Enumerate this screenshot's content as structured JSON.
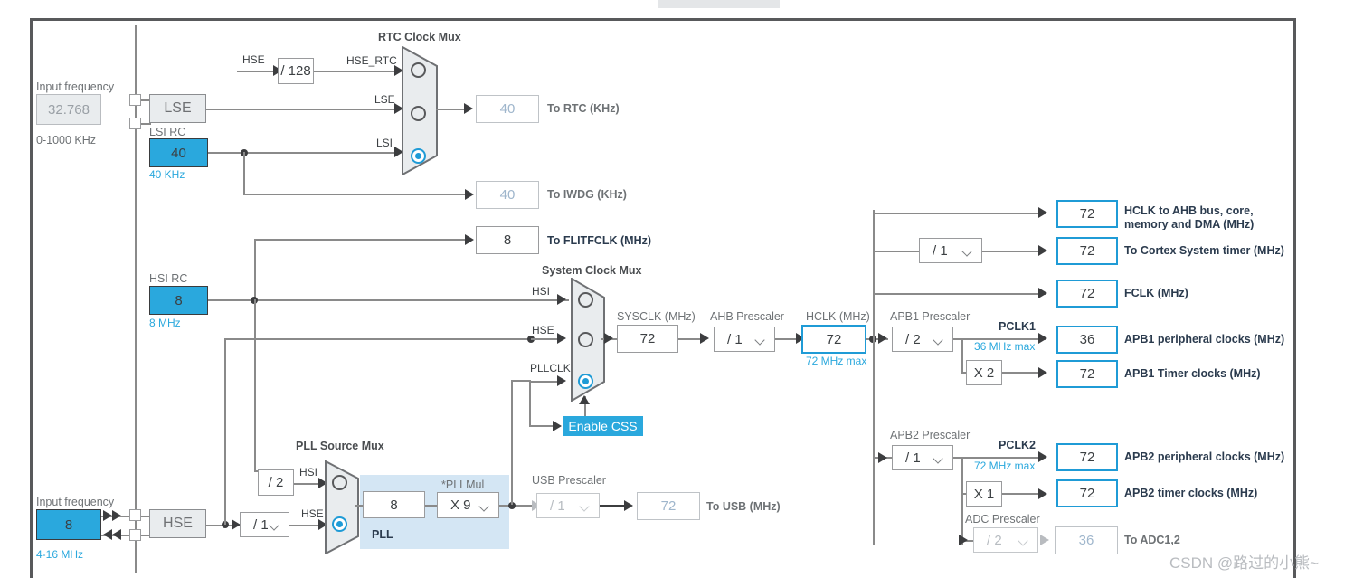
{
  "app": {
    "watermark": "CSDN @路过的小熊~"
  },
  "left_inputs": {
    "lse": {
      "caption": "Input frequency",
      "value": "32.768",
      "range": "0-1000 KHz",
      "osc_label": "LSE"
    },
    "lsi": {
      "title": "LSI RC",
      "value": "40",
      "unit": "40 KHz"
    },
    "hsi": {
      "title": "HSI RC",
      "value": "8",
      "unit": "8 MHz"
    },
    "hse": {
      "caption": "Input frequency",
      "value": "8",
      "range": "4-16 MHz",
      "osc_label": "HSE"
    }
  },
  "rtc_mux": {
    "title": "RTC Clock Mux",
    "hse_in_label": "HSE",
    "divider": "/ 128",
    "hse_rtc_label": "HSE_RTC",
    "lse_label": "LSE",
    "lsi_label": "LSI",
    "selected": "LSI",
    "inputs": [
      "HSE_RTC",
      "LSE",
      "LSI"
    ]
  },
  "outputs_left": [
    {
      "name": "to-rtc",
      "value": "40",
      "label": "To RTC (KHz)",
      "enabled": false
    },
    {
      "name": "to-iwdg",
      "value": "40",
      "label": "To IWDG (KHz)",
      "enabled": false
    },
    {
      "name": "to-flitfclk",
      "value": "8",
      "label": "To FLITFCLK (MHz)",
      "enabled": true
    }
  ],
  "system_clock_mux": {
    "title": "System Clock Mux",
    "inputs": [
      "HSI",
      "HSE",
      "PLLCLK"
    ],
    "selected": "PLLCLK",
    "css_button": "Enable CSS"
  },
  "sysclk": {
    "title": "SYSCLK (MHz)",
    "value": "72"
  },
  "ahb_prescaler": {
    "title": "AHB Prescaler",
    "value": "/ 1"
  },
  "hclk": {
    "title": "HCLK (MHz)",
    "value": "72",
    "max": "72 MHz max"
  },
  "pll_source_mux": {
    "title": "PLL Source Mux",
    "hsi_div": "/ 2",
    "hsi_label": "HSI",
    "hse_div": "/ 1",
    "hse_label": "HSE",
    "selected": "HSE"
  },
  "pll": {
    "zone_label": "PLL",
    "input_value": "8",
    "mul_title": "*PLLMul",
    "mul_value": "X 9"
  },
  "usb": {
    "prescaler_title": "USB Prescaler",
    "prescaler_value": "/ 1",
    "value": "72",
    "label": "To USB (MHz)",
    "enabled": false
  },
  "right_outputs": {
    "hclk_ahb": {
      "value": "72",
      "label_line1": "HCLK to AHB bus, core,",
      "label_line2": "memory and DMA (MHz)"
    },
    "cortex_prescaler": "/ 1",
    "cortex_timer": {
      "value": "72",
      "label": "To Cortex System timer (MHz)"
    },
    "fclk": {
      "value": "72",
      "label": "FCLK (MHz)"
    },
    "apb1": {
      "prescaler_title": "APB1 Prescaler",
      "prescaler_value": "/ 2",
      "pclk_label": "PCLK1",
      "max": "36 MHz max",
      "peripheral": {
        "value": "36",
        "label": "APB1 peripheral clocks (MHz)"
      },
      "multiplier": "X 2",
      "timer": {
        "value": "72",
        "label": "APB1 Timer clocks (MHz)"
      }
    },
    "apb2": {
      "prescaler_title": "APB2 Prescaler",
      "prescaler_value": "/ 1",
      "pclk_label": "PCLK2",
      "max": "72 MHz max",
      "peripheral": {
        "value": "72",
        "label": "APB2 peripheral clocks (MHz)"
      },
      "multiplier": "X 1",
      "timer": {
        "value": "72",
        "label": "APB2 timer clocks (MHz)"
      },
      "adc_prescaler_title": "ADC Prescaler",
      "adc_prescaler_value": "/ 2",
      "adc": {
        "value": "36",
        "label": "To ADC1,2"
      }
    }
  }
}
